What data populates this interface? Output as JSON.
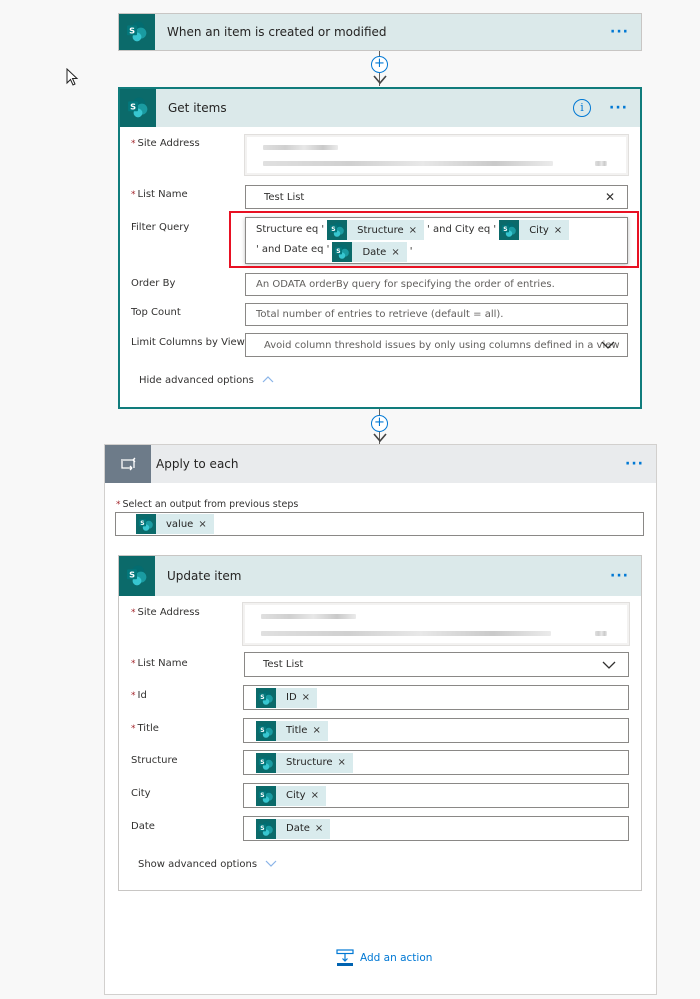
{
  "trigger": {
    "title": "When an item is created or modified",
    "more_label": "···"
  },
  "get_items": {
    "title": "Get items",
    "info_label": "i",
    "more_label": "···",
    "fields": {
      "site_address": {
        "label": "Site Address",
        "required": true
      },
      "list_name": {
        "label": "List Name",
        "required": true,
        "value": "Test List",
        "clear_icon": "✕"
      },
      "filter_query": {
        "label": "Filter Query",
        "parts": [
          {
            "type": "text",
            "value": "Structure eq '"
          },
          {
            "type": "token",
            "value": "Structure"
          },
          {
            "type": "text",
            "value": "' and City eq '"
          },
          {
            "type": "token",
            "value": "City"
          },
          {
            "type": "text",
            "value": "' and Date eq '"
          },
          {
            "type": "token",
            "value": "Date"
          },
          {
            "type": "text",
            "value": "'"
          }
        ]
      },
      "order_by": {
        "label": "Order By",
        "placeholder": "An ODATA orderBy query for specifying the order of entries."
      },
      "top_count": {
        "label": "Top Count",
        "placeholder": "Total number of entries to retrieve (default = all)."
      },
      "limit_columns": {
        "label": "Limit Columns by View",
        "placeholder": "Avoid column threshold issues by only using columns defined in a view"
      }
    },
    "advanced_toggle": "Hide advanced options"
  },
  "apply_to_each": {
    "title": "Apply to each",
    "more_label": "···",
    "output_label": "Select an output from previous steps",
    "output_token": "value"
  },
  "update_item": {
    "title": "Update item",
    "more_label": "···",
    "fields": {
      "site_address": {
        "label": "Site Address",
        "required": true
      },
      "list_name": {
        "label": "List Name",
        "required": true,
        "value": "Test List"
      },
      "id": {
        "label": "Id",
        "required": true,
        "token": "ID"
      },
      "title": {
        "label": "Title",
        "required": true,
        "token": "Title"
      },
      "structure": {
        "label": "Structure",
        "required": false,
        "token": "Structure"
      },
      "city": {
        "label": "City",
        "required": false,
        "token": "City"
      },
      "date": {
        "label": "Date",
        "required": false,
        "token": "Date"
      }
    },
    "advanced_toggle": "Show advanced options"
  },
  "add_action": {
    "label": "Add an action"
  },
  "common": {
    "required_mark": "*",
    "token_remove": "×",
    "plus": "+"
  },
  "colors": {
    "sharepoint_teal": "#0b6a6a",
    "header_bg": "#dbe9ea",
    "token_bg": "#d9ebed",
    "accent_blue": "#0078d4",
    "highlight_red": "#e81123",
    "loop_gray": "#6d7b89"
  }
}
